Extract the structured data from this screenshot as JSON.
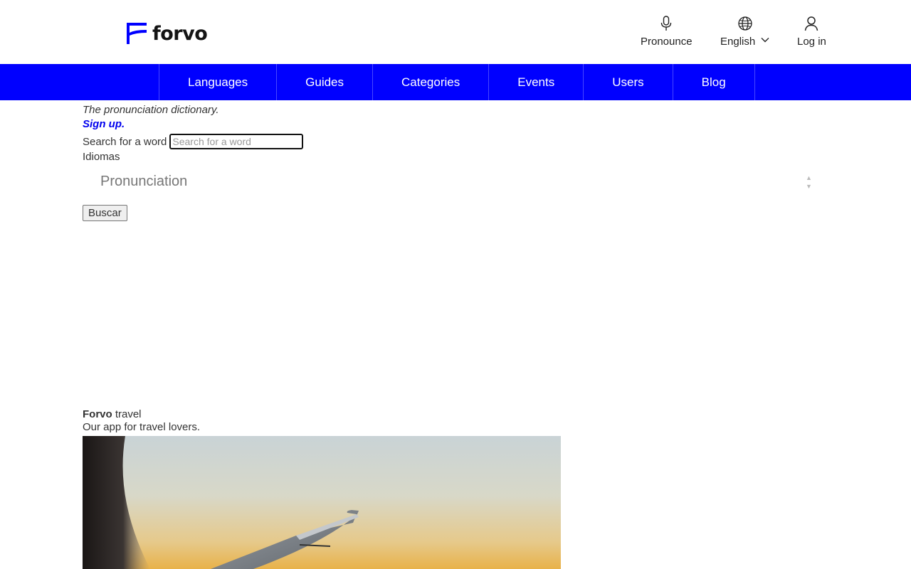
{
  "header": {
    "logo_text": "forvo",
    "pronounce_label": "Pronounce",
    "language_label": "English",
    "login_label": "Log in",
    "icons": {
      "pronounce": "microphone-icon",
      "language": "globe-icon",
      "login": "user-icon",
      "language_dropdown": "chevron-down-icon"
    }
  },
  "nav": {
    "items": [
      {
        "label": "Languages"
      },
      {
        "label": "Guides"
      },
      {
        "label": "Categories"
      },
      {
        "label": "Events"
      },
      {
        "label": "Users"
      },
      {
        "label": "Blog"
      }
    ],
    "background": "#0000ff"
  },
  "main": {
    "tagline": "The pronunciation dictionary.",
    "signup_link": "Sign up.",
    "search_label": "Search for a word",
    "search_placeholder": "Search for a word",
    "search_value": "",
    "languages_label": "Idiomas",
    "select_value": "Pronunciation",
    "submit_label": "Buscar"
  },
  "travel": {
    "brand": "Forvo",
    "title_suffix": " travel",
    "subtitle": "Our app for travel lovers."
  },
  "colors": {
    "brand_blue": "#0000ff",
    "link_blue": "#0000ee",
    "text": "#333333"
  }
}
